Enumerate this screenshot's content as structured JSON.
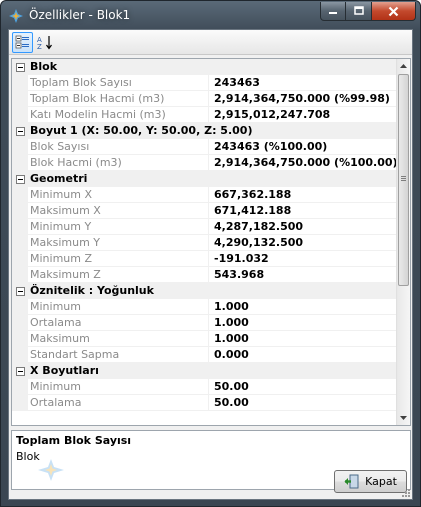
{
  "window": {
    "title": "Özellikler - Blok1",
    "caption_buttons": [
      "minimize",
      "maximize",
      "close"
    ]
  },
  "toolbar": {
    "categorized_icon": "categorized-view-icon",
    "alphabetical_icon": "sort-az-icon",
    "alphabetical_glyph": "A↓Z"
  },
  "grid": {
    "categories": [
      {
        "label": "Blok",
        "properties": [
          {
            "name": "Toplam Blok Sayısı",
            "value": "243463"
          },
          {
            "name": "Toplam Blok Hacmi (m3)",
            "value": "2,914,364,750.000 (%99.98)"
          },
          {
            "name": "Katı Modelin Hacmi (m3)",
            "value": "2,915,012,247.708"
          }
        ]
      },
      {
        "label": "Boyut 1 (X: 50.00, Y: 50.00, Z: 5.00)",
        "properties": [
          {
            "name": "Blok Sayısı",
            "value": "243463 (%100.00)"
          },
          {
            "name": "Blok Hacmi (m3)",
            "value": "2,914,364,750.000 (%100.00)"
          }
        ]
      },
      {
        "label": "Geometri",
        "properties": [
          {
            "name": "Minimum X",
            "value": "667,362.188"
          },
          {
            "name": "Maksimum X",
            "value": "671,412.188"
          },
          {
            "name": "Minimum Y",
            "value": "4,287,182.500"
          },
          {
            "name": "Maksimum Y",
            "value": "4,290,132.500"
          },
          {
            "name": "Minimum Z",
            "value": "-191.032"
          },
          {
            "name": "Maksimum Z",
            "value": "543.968"
          }
        ]
      },
      {
        "label": "Öznitelik : Yoğunluk",
        "properties": [
          {
            "name": "Minimum",
            "value": "1.000"
          },
          {
            "name": "Ortalama",
            "value": "1.000"
          },
          {
            "name": "Maksimum",
            "value": "1.000"
          },
          {
            "name": "Standart Sapma",
            "value": "0.000"
          }
        ]
      },
      {
        "label": "X Boyutları",
        "properties": [
          {
            "name": "Minimum",
            "value": "50.00"
          },
          {
            "name": "Ortalama",
            "value": "50.00"
          }
        ]
      }
    ]
  },
  "help": {
    "title": "Toplam Blok Sayısı",
    "description": "Blok"
  },
  "footer": {
    "close_label": "Kapat"
  },
  "colors": {
    "title_bar": "#4a5866",
    "category_bg": "#f0f0f0",
    "property_name": "#8a8a8a",
    "selection_border": "#3399ff"
  }
}
